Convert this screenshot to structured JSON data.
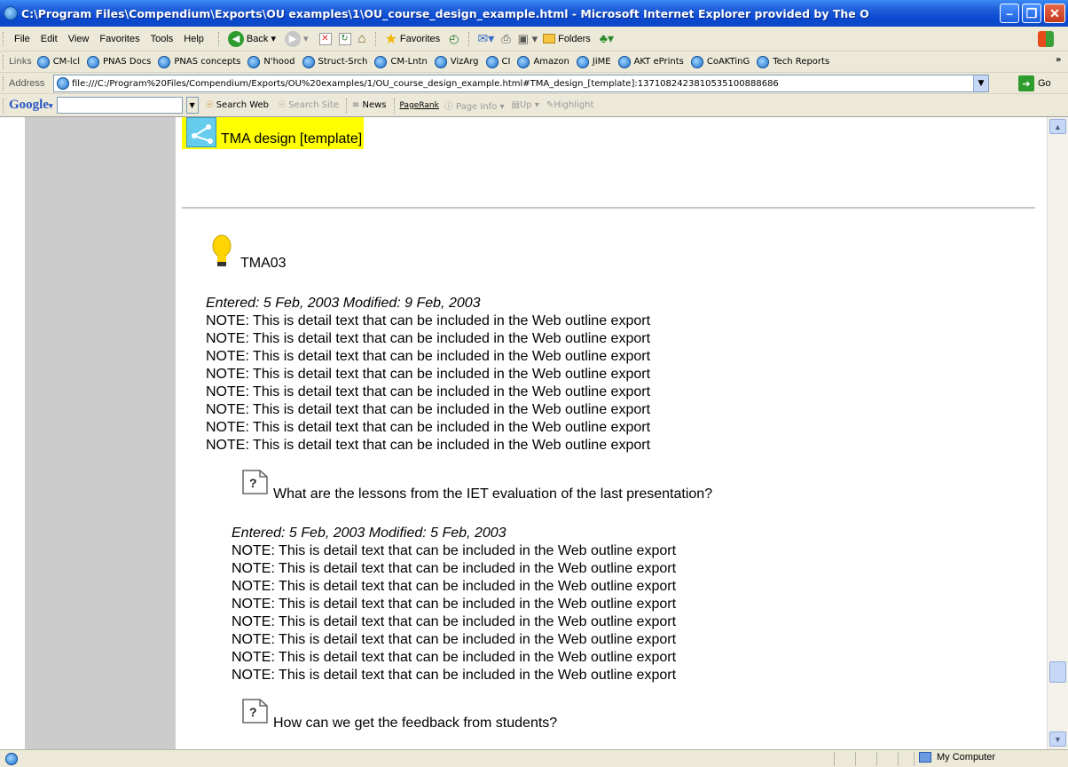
{
  "window": {
    "title": "C:\\Program Files\\Compendium\\Exports\\OU examples\\1\\OU_course_design_example.html - Microsoft Internet Explorer provided by The O"
  },
  "menu": [
    "File",
    "Edit",
    "View",
    "Favorites",
    "Tools",
    "Help"
  ],
  "toolbar": {
    "back": "Back",
    "favorites": "Favorites",
    "folders": "Folders"
  },
  "links": {
    "label": "Links",
    "items": [
      "CM-lcl",
      "PNAS Docs",
      "PNAS concepts",
      "N'hood",
      "Struct-Srch",
      "CM-Lntn",
      "VizArg",
      "CI",
      "Amazon",
      "JiME",
      "AKT ePrints",
      "CoAKTinG",
      "Tech Reports"
    ]
  },
  "address": {
    "label": "Address",
    "url": "file:///C:/Program%20Files/Compendium/Exports/OU%20examples/1/OU_course_design_example.html#TMA_design_[template]:1371082423810535100888686",
    "go": "Go"
  },
  "google": {
    "logo": "Google",
    "search_web": "Search Web",
    "search_site": "Search Site",
    "news": "News",
    "pagerank": "PageRank",
    "page_info": "Page Info",
    "up": "Up",
    "highlight": "Highlight"
  },
  "page": {
    "map_title": "TMA design [template]",
    "node1": {
      "title": "TMA03",
      "meta": "Entered: 5 Feb, 2003  Modified: 9 Feb, 2003",
      "notes": [
        "NOTE: This is detail text that can be included in the Web outline export",
        "NOTE: This is detail text that can be included in the Web outline export",
        "NOTE: This is detail text that can be included in the Web outline export",
        "NOTE: This is detail text that can be included in the Web outline export",
        "NOTE: This is detail text that can be included in the Web outline export",
        "NOTE: This is detail text that can be included in the Web outline export",
        "NOTE: This is detail text that can be included in the Web outline export",
        "NOTE: This is detail text that can be included in the Web outline export"
      ]
    },
    "node2": {
      "title": "What are the lessons from the IET evaluation of the last presentation?",
      "meta": "Entered: 5 Feb, 2003  Modified: 5 Feb, 2003",
      "notes": [
        "NOTE: This is detail text that can be included in the Web outline export",
        "NOTE: This is detail text that can be included in the Web outline export",
        "NOTE: This is detail text that can be included in the Web outline export",
        "NOTE: This is detail text that can be included in the Web outline export",
        "NOTE: This is detail text that can be included in the Web outline export",
        "NOTE: This is detail text that can be included in the Web outline export",
        "NOTE: This is detail text that can be included in the Web outline export",
        "NOTE: This is detail text that can be included in the Web outline export"
      ]
    },
    "node3": {
      "title": "How can we get the feedback from students?"
    }
  },
  "status": {
    "zone": "My Computer"
  }
}
